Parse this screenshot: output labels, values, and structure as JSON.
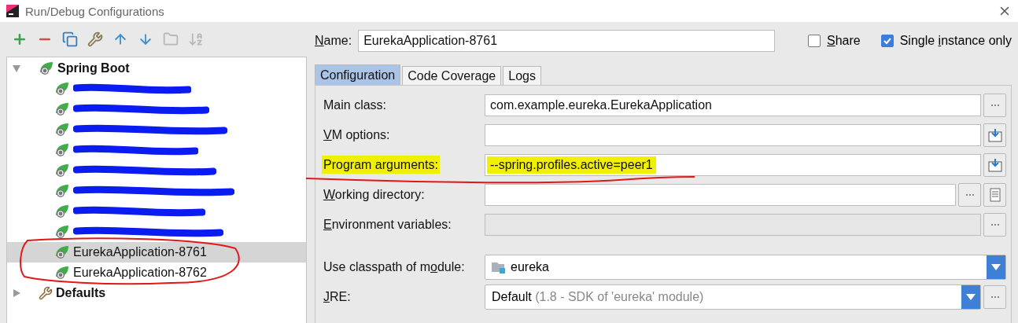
{
  "window": {
    "title": "Run/Debug Configurations"
  },
  "toolbar": [
    {
      "kind": "add",
      "disabled": false
    },
    {
      "kind": "remove",
      "disabled": false
    },
    {
      "kind": "copy",
      "disabled": false
    },
    {
      "kind": "edit",
      "disabled": false
    },
    {
      "kind": "up",
      "disabled": false
    },
    {
      "kind": "down",
      "disabled": false
    },
    {
      "kind": "folder",
      "disabled": true
    },
    {
      "kind": "sort",
      "disabled": true
    }
  ],
  "tree": [
    {
      "label": "Spring Boot",
      "kind": "spring",
      "expanded": true,
      "children": [
        {
          "kind": "redacted",
          "selected": false,
          "circled": false
        },
        {
          "kind": "redacted",
          "selected": false,
          "circled": false
        },
        {
          "kind": "redacted",
          "selected": false,
          "circled": false
        },
        {
          "kind": "redacted",
          "selected": false,
          "circled": false
        },
        {
          "kind": "redacted",
          "selected": false,
          "circled": false
        },
        {
          "kind": "redacted",
          "selected": false,
          "circled": false
        },
        {
          "kind": "redacted",
          "selected": false,
          "circled": false
        },
        {
          "kind": "redacted",
          "selected": false,
          "circled": false
        },
        {
          "kind": "spring",
          "label": "EurekaApplication-8761",
          "selected": true,
          "circled": true
        },
        {
          "kind": "spring",
          "label": "EurekaApplication-8762",
          "selected": false,
          "circled": true
        }
      ]
    },
    {
      "label": "Defaults",
      "kind": "defaults",
      "expanded": false
    }
  ],
  "name_field": {
    "label": {
      "key": "N",
      "post": "ame:"
    },
    "value": "EurekaApplication-8761"
  },
  "options": [
    {
      "label": {
        "key": "S",
        "post": "hare"
      },
      "checked": false
    },
    {
      "label": {
        "pre": "Single ",
        "key": "i",
        "post": "nstance only"
      },
      "checked": true
    }
  ],
  "tabs": [
    {
      "label": "Configuration",
      "selected": true
    },
    {
      "label": "Code Coverage",
      "selected": false
    },
    {
      "label": "Logs",
      "selected": false
    }
  ],
  "fields": [
    {
      "kind": "text",
      "label": {
        "pre": "Main class:"
      },
      "value": "com.example.eureka.EurekaApplication",
      "buttons": [
        {
          "kind": "browse"
        }
      ]
    },
    {
      "kind": "text",
      "label": {
        "key": "V",
        "post": "M options:"
      },
      "buttons": [
        {
          "kind": "insert"
        }
      ]
    },
    {
      "kind": "text",
      "label": {
        "pre": "Program ar",
        "key": "g",
        "post": "uments:"
      },
      "value": "--spring.profiles.active=peer1",
      "buttons": [
        {
          "kind": "insert"
        }
      ],
      "highlighted": true,
      "underlined": true
    },
    {
      "kind": "text",
      "label": {
        "key": "W",
        "post": "orking directory:"
      },
      "buttons": [
        {
          "kind": "browse"
        },
        {
          "kind": "file"
        }
      ]
    },
    {
      "kind": "text",
      "label": {
        "key": "E",
        "post": "nvironment variables:"
      },
      "disabled": true,
      "buttons": [
        {
          "kind": "browse"
        }
      ]
    },
    {
      "kind": "module",
      "label": {
        "pre": "Use classpath of m",
        "key": "o",
        "post": "dule:"
      },
      "value": "eureka"
    },
    {
      "kind": "combo",
      "label": {
        "key": "J",
        "post": "RE:"
      },
      "value": "Default",
      "hint": "(1.8 - SDK of 'eureka' module)",
      "buttons": [
        {
          "kind": "browse"
        }
      ]
    }
  ]
}
